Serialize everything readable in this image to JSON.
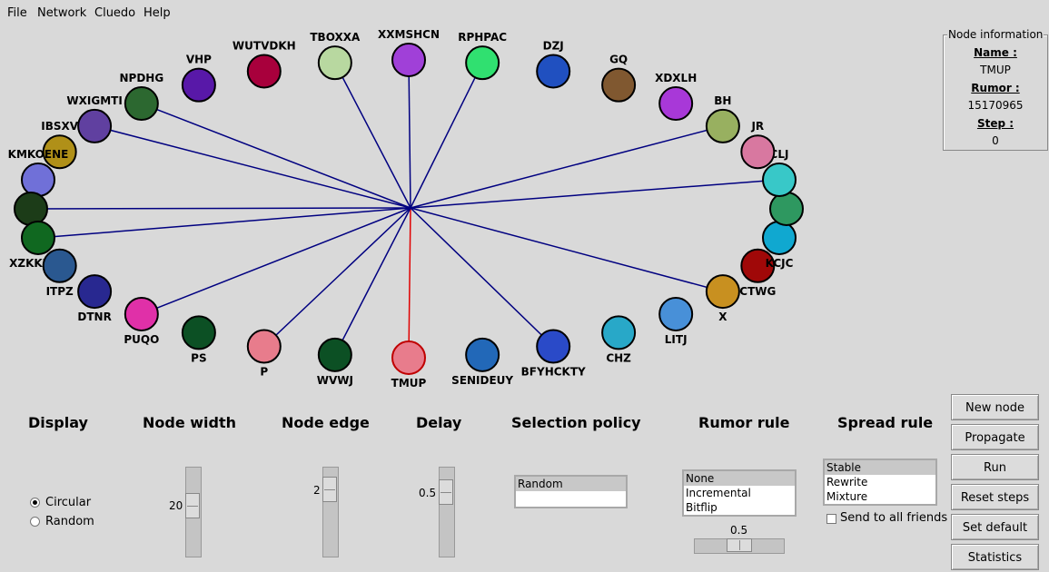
{
  "menu": {
    "items": [
      "File",
      "Network",
      "Cluedo",
      "Help"
    ]
  },
  "graph": {
    "hub_color": "#000080",
    "highlight_color": "#e00000",
    "nodes": [
      {
        "name": "TMUP",
        "color": "#e87c8c",
        "ring": "#c00000"
      },
      {
        "name": "SENIDEUY",
        "color": "#2268b8"
      },
      {
        "name": "BFYHCKTY",
        "color": "#2a4ac8"
      },
      {
        "name": "CHZ",
        "color": "#28a8c8"
      },
      {
        "name": "LITJ",
        "color": "#4890d8"
      },
      {
        "name": "X",
        "color": "#c89020"
      },
      {
        "name": "CTWG",
        "color": "#a00808"
      },
      {
        "name": "KCJC",
        "color": "#10a8d0"
      },
      {
        "name": "",
        "color": "#2e9860"
      },
      {
        "name": "CLJ",
        "color": "#38c8c8"
      },
      {
        "name": "JR",
        "color": "#d878a0"
      },
      {
        "name": "BH",
        "color": "#98b060"
      },
      {
        "name": "XDXLH",
        "color": "#a838d8"
      },
      {
        "name": "GQ",
        "color": "#805830"
      },
      {
        "name": "DZJ",
        "color": "#2050c0"
      },
      {
        "name": "RPHPAC",
        "color": "#30e070"
      },
      {
        "name": "XXMSHCN",
        "color": "#a040d8"
      },
      {
        "name": "TBOXXA",
        "color": "#b8d8a0"
      },
      {
        "name": "WUTVDKH",
        "color": "#a8003c"
      },
      {
        "name": "VHP",
        "color": "#5818a8"
      },
      {
        "name": "NPDHG",
        "color": "#2c6830"
      },
      {
        "name": "WXIGMTI",
        "color": "#6040a0"
      },
      {
        "name": "IBSXV",
        "color": "#b09018"
      },
      {
        "name": "KMKOENE",
        "color": "#7070d8"
      },
      {
        "name": "",
        "color": "#1c3c18"
      },
      {
        "name": "XZKKUJIZ",
        "color": "#106820"
      },
      {
        "name": "ITPZ",
        "color": "#2a5890"
      },
      {
        "name": "DTNR",
        "color": "#282890"
      },
      {
        "name": "PUQO",
        "color": "#e030a8"
      },
      {
        "name": "PS",
        "color": "#0c5024"
      },
      {
        "name": "P",
        "color": "#e87c8c"
      },
      {
        "name": "WVWJ",
        "color": "#0c5024"
      }
    ],
    "links": [
      0,
      2,
      5,
      9,
      11,
      15,
      16,
      17,
      20,
      21,
      24,
      25,
      28,
      30,
      31
    ]
  },
  "info": {
    "legend": "Node information",
    "name_label": "Name :",
    "name_value": "TMUP",
    "rumor_label": "Rumor :",
    "rumor_value": "15170965",
    "step_label": "Step :",
    "step_value": "0"
  },
  "controls": {
    "display": {
      "heading": "Display",
      "options": [
        "Circular",
        "Random"
      ],
      "selected": "Circular"
    },
    "node_width": {
      "heading": "Node width",
      "value": "20"
    },
    "node_edge": {
      "heading": "Node edge",
      "value": "2"
    },
    "delay": {
      "heading": "Delay",
      "value": "0.5"
    },
    "selection_policy": {
      "heading": "Selection policy",
      "options": [
        "Random"
      ],
      "selected": "Random"
    },
    "rumor_rule": {
      "heading": "Rumor rule",
      "options": [
        "None",
        "Incremental",
        "Bitflip"
      ],
      "selected": "None",
      "slider_value": "0.5"
    },
    "spread_rule": {
      "heading": "Spread rule",
      "options": [
        "Stable",
        "Rewrite",
        "Mixture"
      ],
      "selected": "Stable",
      "send_all_label": "Send to all friends",
      "send_all_checked": false
    }
  },
  "buttons": {
    "new_node": "New node",
    "propagate": "Propagate",
    "run": "Run",
    "reset_steps": "Reset steps",
    "set_default": "Set default",
    "statistics": "Statistics"
  }
}
